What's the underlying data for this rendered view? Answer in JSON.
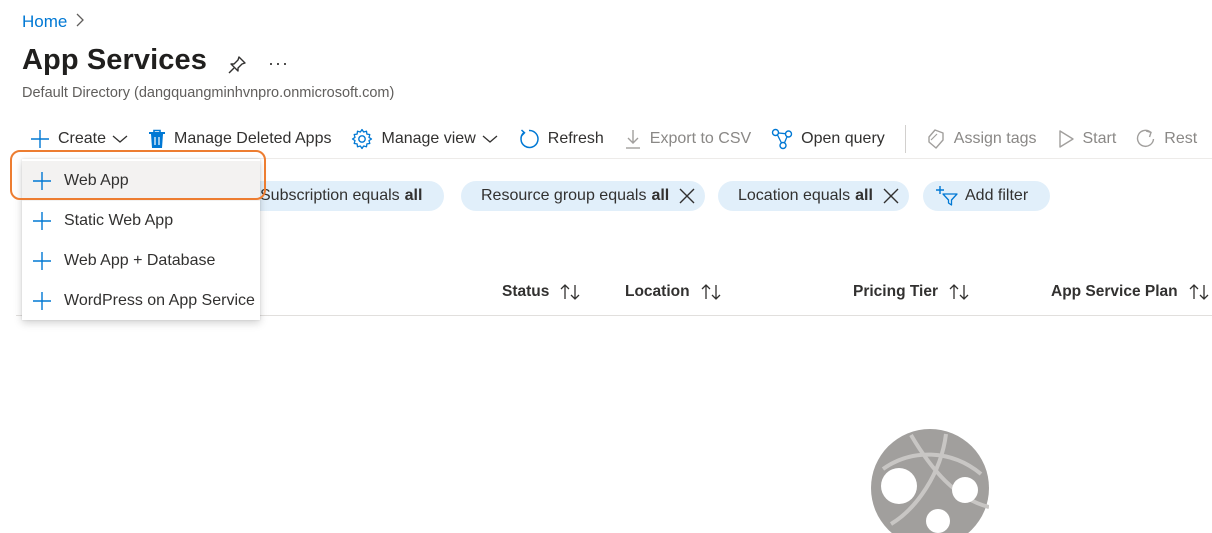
{
  "breadcrumb": {
    "home": "Home"
  },
  "page": {
    "title": "App Services",
    "more": "···",
    "subtitle": "Default Directory (dangquangminhvnpro.onmicrosoft.com)"
  },
  "toolbar": {
    "create": "Create",
    "manage_deleted": "Manage Deleted Apps",
    "manage_view": "Manage view",
    "refresh": "Refresh",
    "export_csv": "Export to CSV",
    "open_query": "Open query",
    "assign_tags": "Assign tags",
    "start": "Start",
    "restart": "Rest"
  },
  "filters": [
    {
      "label": "Subscription equals",
      "value": "all"
    },
    {
      "label": "Resource group equals",
      "value": "all"
    },
    {
      "label": "Location equals",
      "value": "all"
    },
    {
      "label": "Add filter"
    }
  ],
  "columns": [
    "Status",
    "Location",
    "Pricing Tier",
    "App Service Plan"
  ],
  "create_menu": {
    "items": [
      "Web App",
      "Static Web App",
      "Web App + Database",
      "WordPress on App Service"
    ]
  },
  "colors": {
    "accent": "#0078d4",
    "pill_bg": "#e1effa",
    "highlight": "#ed7d31",
    "disabled": "#8a8886"
  }
}
